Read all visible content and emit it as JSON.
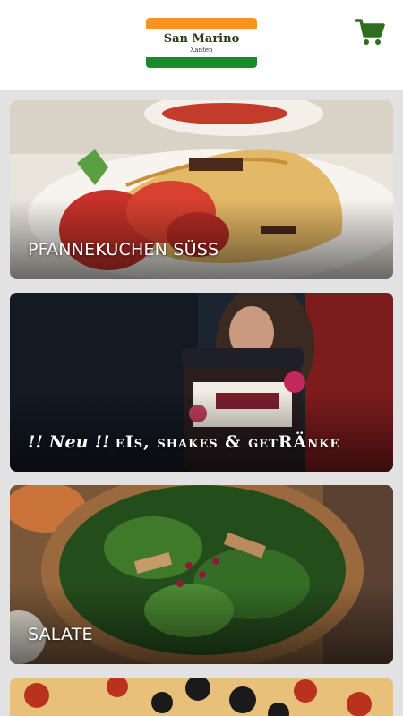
{
  "header": {
    "logo": {
      "name": "San Marino",
      "city": "Xanten"
    },
    "cart_icon": "shopping-cart-icon",
    "colors": {
      "logo_orange": "#f7931e",
      "logo_green": "#1a8a2e",
      "cart_green": "#2e6e1e"
    }
  },
  "categories": [
    {
      "label": "PFANNEKUCHEN SÜSS"
    },
    {
      "prefix": "!! Neu !!",
      "label": "eIs, shakes & getRÄnke"
    },
    {
      "label": "SALATE"
    },
    {
      "label": ""
    }
  ]
}
